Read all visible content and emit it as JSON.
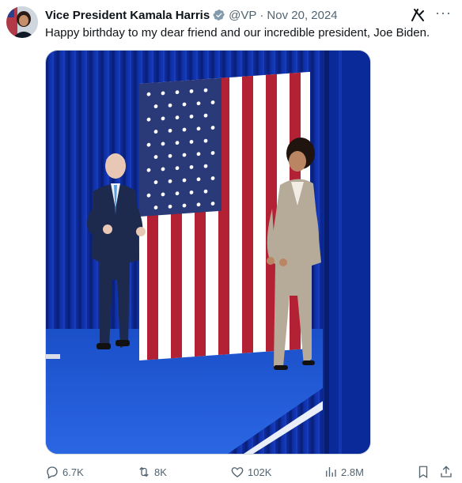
{
  "author": {
    "display_name": "Vice President Kamala Harris",
    "handle": "@VP",
    "separator": "·",
    "date": "Nov 20, 2024"
  },
  "tweet": {
    "text": "Happy birthday to my dear friend and our incredible president, Joe Biden."
  },
  "actions": {
    "replies": "6.7K",
    "reposts": "8K",
    "likes": "102K",
    "views": "2.8M"
  },
  "icons": [
    "verified-badge-icon",
    "grok-icon",
    "more-icon",
    "reply-icon",
    "repost-icon",
    "like-icon",
    "views-icon",
    "bookmark-icon",
    "share-icon"
  ],
  "colors": {
    "verified": "#829aab",
    "text": "#0f1419",
    "secondary": "#536471",
    "curtain": "#0b2a9a",
    "carpet": "#1e5bd6"
  }
}
